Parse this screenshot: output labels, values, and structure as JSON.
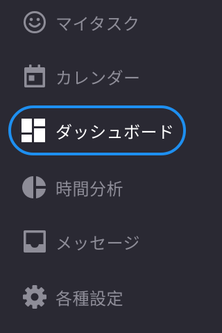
{
  "colors": {
    "background": "#2a2933",
    "icon_inactive": "#8e8d98",
    "text_inactive": "#8e8d98",
    "text_active": "#ffffff",
    "highlight": "#1e8ff0"
  },
  "sidebar": {
    "items": [
      {
        "label": "マイタスク",
        "icon": "smiley-icon",
        "active": false
      },
      {
        "label": "カレンダー",
        "icon": "calendar-icon",
        "active": false
      },
      {
        "label": "ダッシュボード",
        "icon": "dashboard-icon",
        "active": true
      },
      {
        "label": "時間分析",
        "icon": "pie-chart-icon",
        "active": false
      },
      {
        "label": "メッセージ",
        "icon": "inbox-icon",
        "active": false
      },
      {
        "label": "各種設定",
        "icon": "gear-icon",
        "active": false
      }
    ]
  }
}
